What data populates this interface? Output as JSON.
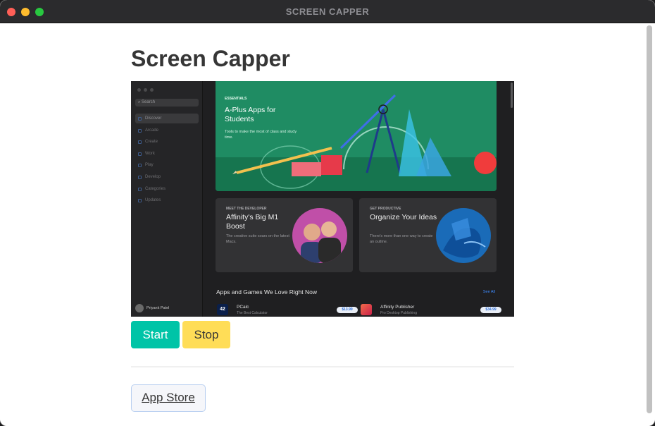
{
  "window": {
    "title": "SCREEN CAPPER"
  },
  "page": {
    "title": "Screen Capper"
  },
  "screenshot": {
    "sidebar": {
      "search_placeholder": "Search",
      "items": [
        {
          "label": "Discover",
          "active": true
        },
        {
          "label": "Arcade"
        },
        {
          "label": "Create"
        },
        {
          "label": "Work"
        },
        {
          "label": "Play"
        },
        {
          "label": "Develop"
        },
        {
          "label": "Categories"
        },
        {
          "label": "Updates"
        }
      ],
      "user": "Priyank Patel"
    },
    "hero": {
      "eyebrow": "ESSENTIALS",
      "title": "A-Plus Apps for Students",
      "description": "Tools to make the most of class and study time."
    },
    "cards": [
      {
        "eyebrow": "MEET THE DEVELOPER",
        "title": "Affinity's Big M1 Boost",
        "description": "The creative suite soars on the latest Macs."
      },
      {
        "eyebrow": "GET PRODUCTIVE",
        "title": "Organize Your Ideas",
        "description": "There's more than one way to create an outline."
      }
    ],
    "section": {
      "title": "Apps and Games We Love Right Now",
      "see_all": "See All"
    },
    "apps": [
      {
        "name": "PCalc",
        "subtitle": "The Best Calculator",
        "price": "$13.99",
        "icon_text": "42"
      },
      {
        "name": "Affinity Publisher",
        "subtitle": "Pro Desktop Publishing",
        "price": "$34.99"
      }
    ]
  },
  "buttons": {
    "start": "Start",
    "stop": "Stop",
    "app_store": "App Store"
  },
  "colors": {
    "start": "#00c4a7",
    "stop": "#ffdd57",
    "hero": "#1f8c63"
  }
}
